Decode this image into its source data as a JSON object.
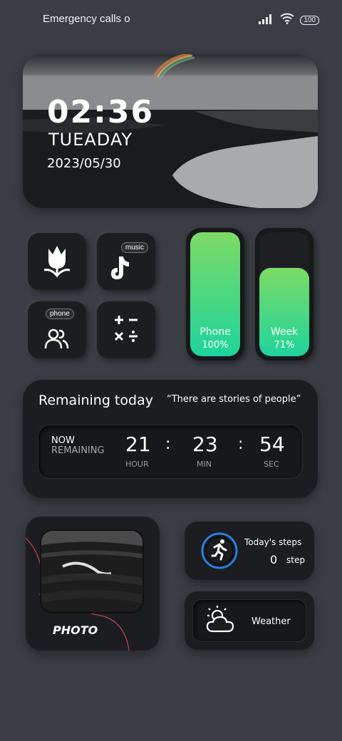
{
  "status_bar": {
    "carrier_text": "Emergency calls o",
    "battery_level": "100",
    "icons": [
      "signal-icon",
      "wifi-icon",
      "battery-icon"
    ]
  },
  "clock": {
    "time": "02:36",
    "day": "TUEADAY",
    "date": "2023/05/30"
  },
  "apps": {
    "music_bubble": "music",
    "phone_bubble": "phone",
    "icons": [
      "tulip-icon",
      "tiktok-icon",
      "contacts-icon",
      "calculator-icon"
    ]
  },
  "progress": {
    "phone": {
      "label": "Phone",
      "value_text": "100%",
      "fraction": 1.0
    },
    "week": {
      "label": "Week",
      "value_text": "71%",
      "fraction": 0.71
    }
  },
  "countdown": {
    "title": "Remaining today",
    "quote": "“There are stories of people”",
    "now_label": "NOW",
    "remaining_label": "REMAINING",
    "hours": "21",
    "minutes": "23",
    "seconds": "54",
    "hour_unit": "HOUR",
    "min_unit": "MIN",
    "sec_unit": "SEC",
    "separator": ":"
  },
  "photo": {
    "label": "PHOTO"
  },
  "steps": {
    "title": "Today's steps",
    "count": "0",
    "unit": "step"
  },
  "weather": {
    "label": "Weather"
  },
  "colors": {
    "background": "#3a3e44",
    "card": "#1c1d20",
    "progress_top": "#7ddb66",
    "progress_bottom": "#1ed49c",
    "steps_ring": "#2b7de0"
  }
}
